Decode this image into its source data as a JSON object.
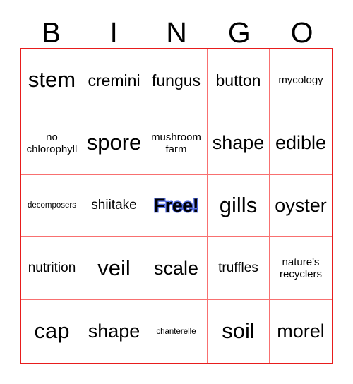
{
  "card": {
    "title": "BINGO",
    "header_letters": [
      "B",
      "I",
      "N",
      "G",
      "O"
    ],
    "grid_size": "5x5",
    "colors": {
      "outer_border": "#e81d1d",
      "inner_gridline": "#f87070",
      "text": "#000000",
      "background": "#ffffff",
      "free_space_outline": "#3a55d8"
    },
    "free_space": {
      "label": "Free!",
      "row": 3,
      "column": 3
    },
    "rows": [
      {
        "cells": [
          {
            "text": "stem",
            "size": "xxl",
            "lines": 1
          },
          {
            "text": "cremini",
            "size": "lg",
            "lines": 1
          },
          {
            "text": "fungus",
            "size": "lg",
            "lines": 1
          },
          {
            "text": "button",
            "size": "lg",
            "lines": 1
          },
          {
            "text": "mycology",
            "size": "sm",
            "lines": 1
          }
        ]
      },
      {
        "cells": [
          {
            "text": "no\nchlorophyll",
            "size": "sm",
            "lines": 2
          },
          {
            "text": "spore",
            "size": "xxl",
            "lines": 1
          },
          {
            "text": "mushroom\nfarm",
            "size": "sm",
            "lines": 2
          },
          {
            "text": "shape",
            "size": "xl",
            "lines": 1
          },
          {
            "text": "edible",
            "size": "xl",
            "lines": 1
          }
        ]
      },
      {
        "cells": [
          {
            "text": "decomposers",
            "size": "xs",
            "lines": 1
          },
          {
            "text": "shiitake",
            "size": "md",
            "lines": 1
          },
          {
            "text": "Free!",
            "size": "xl",
            "lines": 1,
            "free": true
          },
          {
            "text": "gills",
            "size": "xxl",
            "lines": 1
          },
          {
            "text": "oyster",
            "size": "xl",
            "lines": 1
          }
        ]
      },
      {
        "cells": [
          {
            "text": "nutrition",
            "size": "md",
            "lines": 1
          },
          {
            "text": "veil",
            "size": "xxl",
            "lines": 1
          },
          {
            "text": "scale",
            "size": "xl",
            "lines": 1
          },
          {
            "text": "truffles",
            "size": "md",
            "lines": 1
          },
          {
            "text": "nature's\nrecyclers",
            "size": "sm",
            "lines": 2
          }
        ]
      },
      {
        "cells": [
          {
            "text": "cap",
            "size": "xxl",
            "lines": 1
          },
          {
            "text": "shape",
            "size": "xl",
            "lines": 1
          },
          {
            "text": "chanterelle",
            "size": "xs",
            "lines": 1
          },
          {
            "text": "soil",
            "size": "xxl",
            "lines": 1
          },
          {
            "text": "morel",
            "size": "xl",
            "lines": 1
          }
        ]
      }
    ]
  }
}
